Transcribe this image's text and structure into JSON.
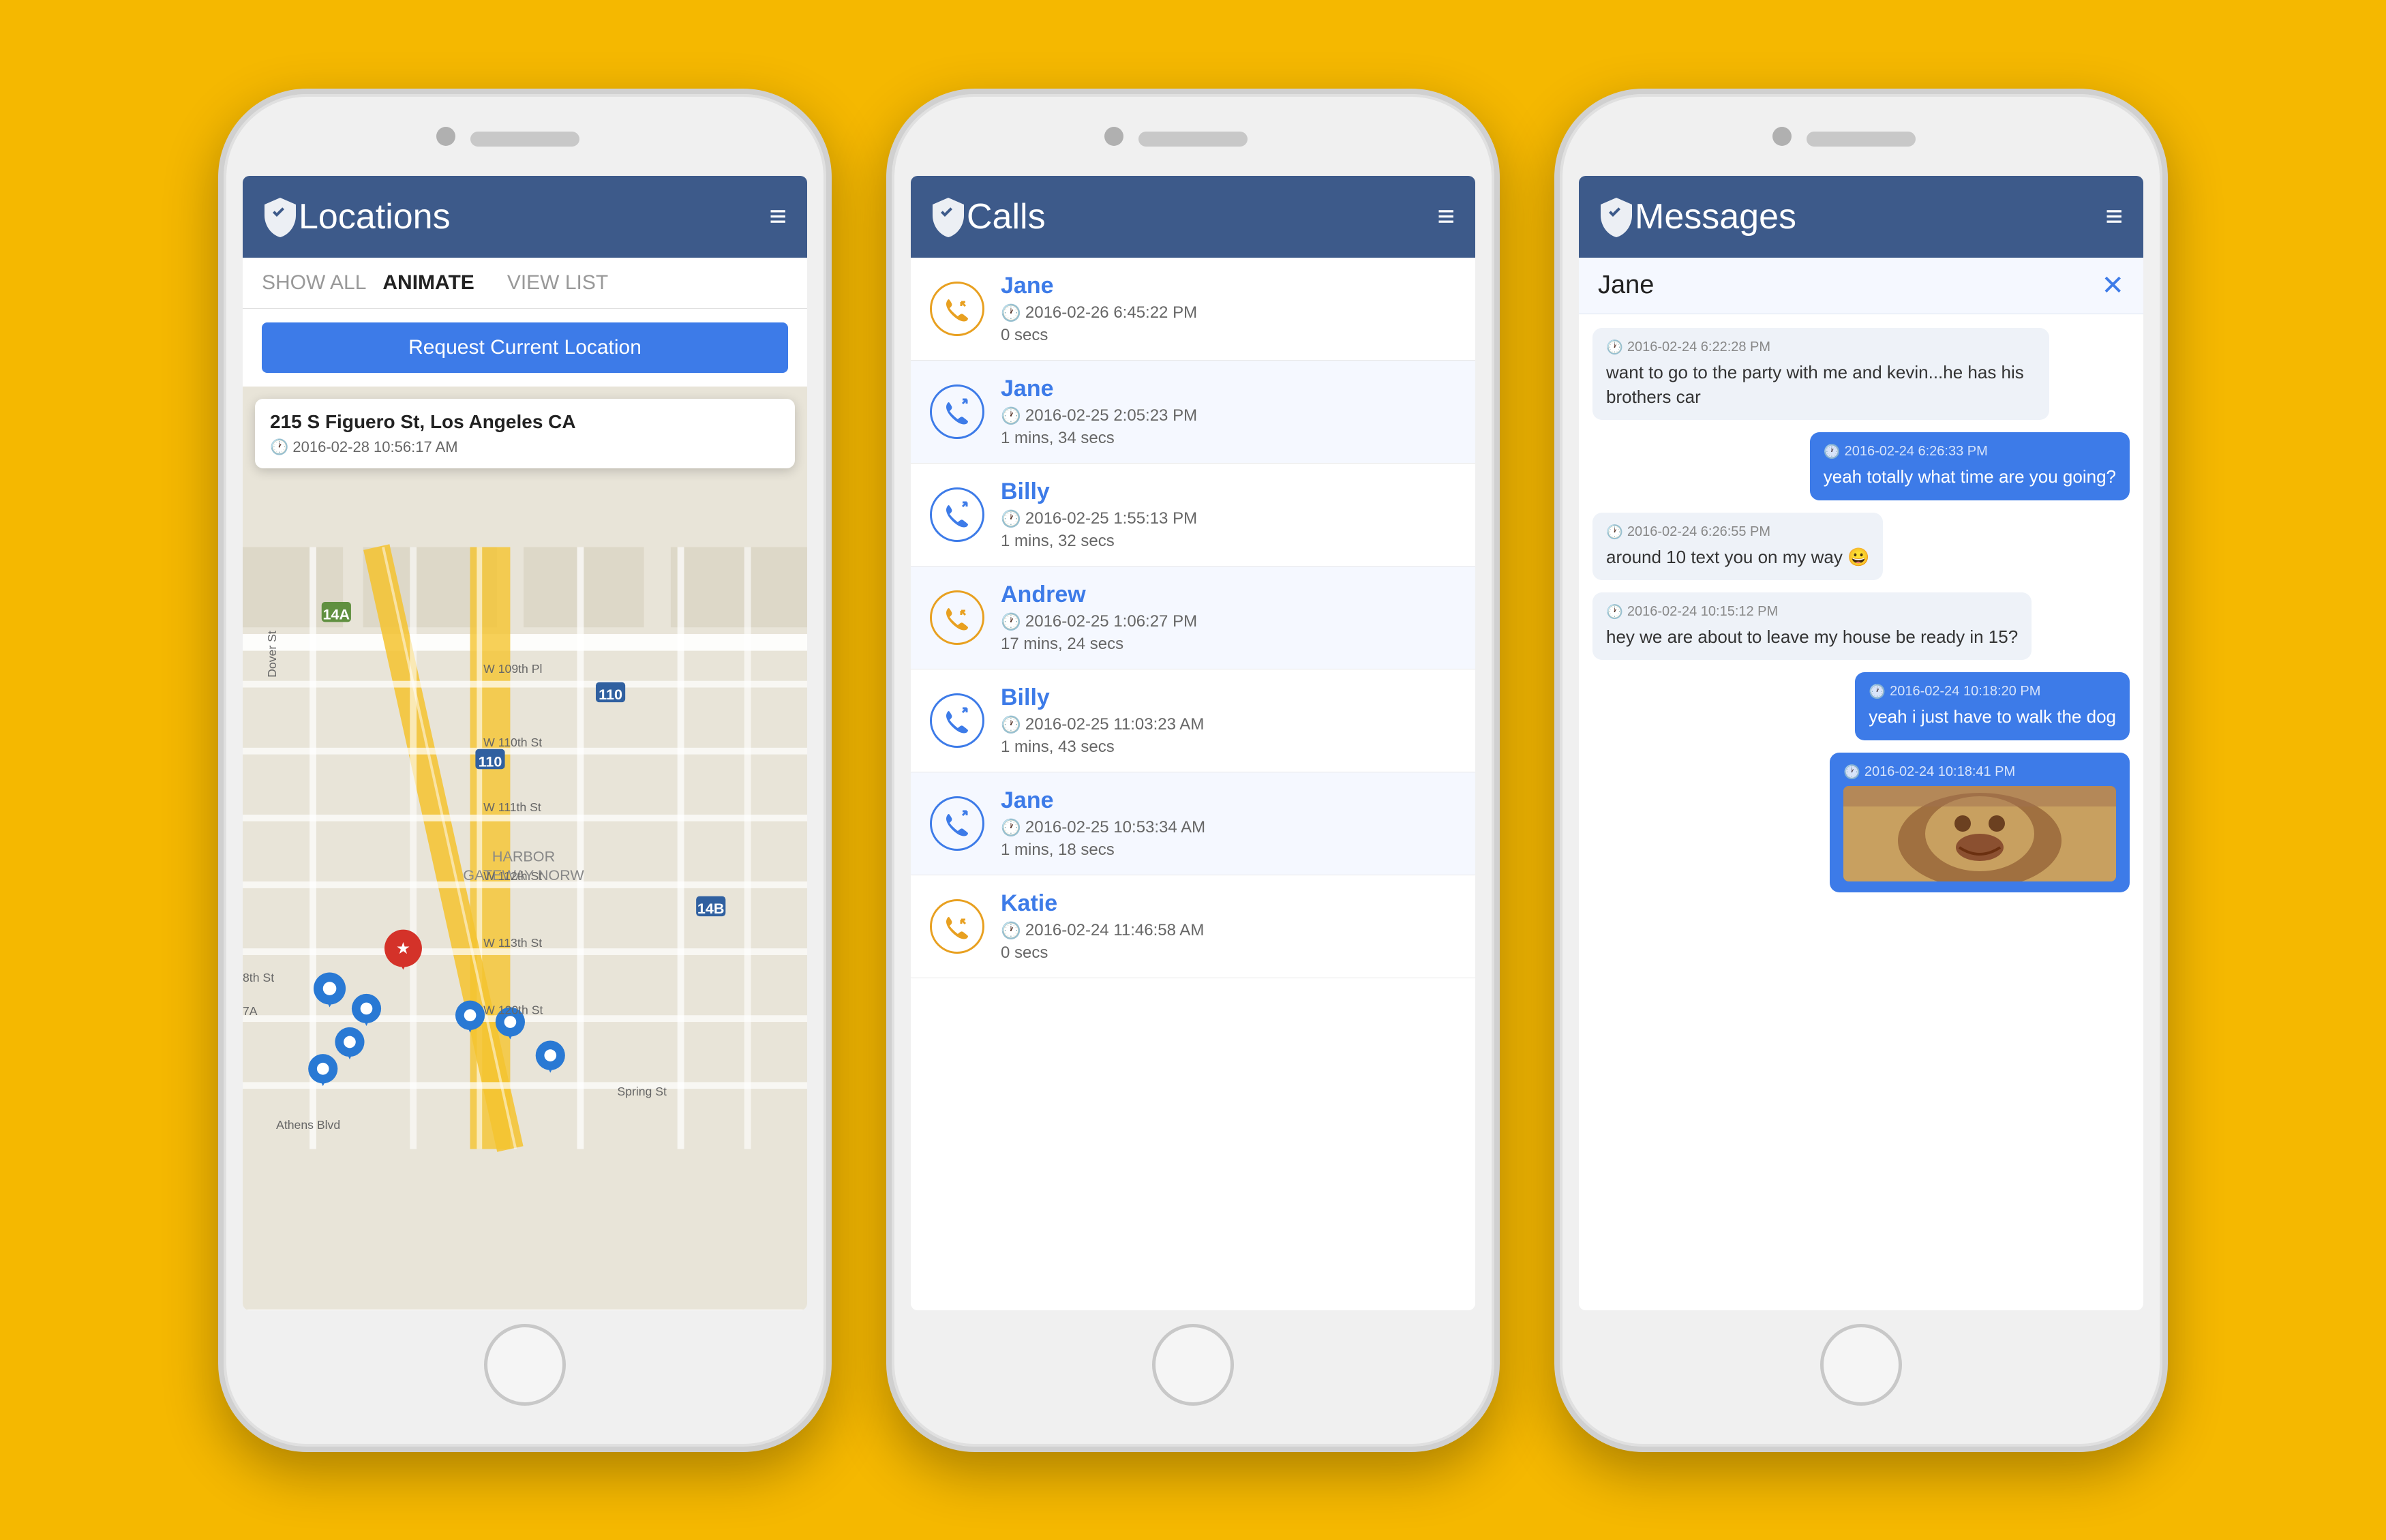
{
  "background_color": "#F5B800",
  "phones": [
    {
      "id": "locations",
      "header": {
        "title": "Locations",
        "menu_label": "≡"
      },
      "toolbar": {
        "show_all": "SHOW ALL",
        "animate": "ANIMATE",
        "view_list": "VIEW LIST",
        "active": "ANIMATE"
      },
      "request_button": "Request Current Location",
      "map": {
        "popup": {
          "address": "215 S Figuero St, Los Angeles CA",
          "time": "2016-02-28 10:56:17 AM"
        },
        "pins": []
      }
    },
    {
      "id": "calls",
      "header": {
        "title": "Calls",
        "menu_label": "≡"
      },
      "calls": [
        {
          "name": "Jane",
          "datetime": "2016-02-26 6:45:22 PM",
          "duration": "0 secs",
          "type": "incoming"
        },
        {
          "name": "Jane",
          "datetime": "2016-02-25 2:05:23 PM",
          "duration": "1 mins, 34 secs",
          "type": "outgoing"
        },
        {
          "name": "Billy",
          "datetime": "2016-02-25 1:55:13 PM",
          "duration": "1 mins, 32 secs",
          "type": "outgoing"
        },
        {
          "name": "Andrew",
          "datetime": "2016-02-25 1:06:27 PM",
          "duration": "17 mins, 24 secs",
          "type": "incoming"
        },
        {
          "name": "Billy",
          "datetime": "2016-02-25 11:03:23 AM",
          "duration": "1 mins, 43 secs",
          "type": "outgoing"
        },
        {
          "name": "Jane",
          "datetime": "2016-02-25 10:53:34 AM",
          "duration": "1 mins, 18 secs",
          "type": "outgoing"
        },
        {
          "name": "Katie",
          "datetime": "2016-02-24 11:46:58 AM",
          "duration": "0 secs",
          "type": "incoming"
        }
      ]
    },
    {
      "id": "messages",
      "header": {
        "title": "Messages",
        "menu_label": "≡"
      },
      "contact": "Jane",
      "close_label": "✕",
      "messages": [
        {
          "sent": false,
          "time": "2016-02-24 6:22:28 PM",
          "text": "want to go to the party with me and kevin...he has his brothers car"
        },
        {
          "sent": true,
          "time": "2016-02-24 6:26:33 PM",
          "text": "yeah totally what time are you going?"
        },
        {
          "sent": false,
          "time": "2016-02-24 6:26:55 PM",
          "text": "around 10 text you on my way 😀"
        },
        {
          "sent": false,
          "time": "2016-02-24 10:15:12 PM",
          "text": "hey we are about to leave my house be ready in 15?"
        },
        {
          "sent": true,
          "time": "2016-02-24 10:18:20 PM",
          "text": "yeah i just have to walk the dog"
        },
        {
          "sent": true,
          "time": "2016-02-24 10:18:41 PM",
          "text": "",
          "is_image": true
        }
      ]
    }
  ]
}
